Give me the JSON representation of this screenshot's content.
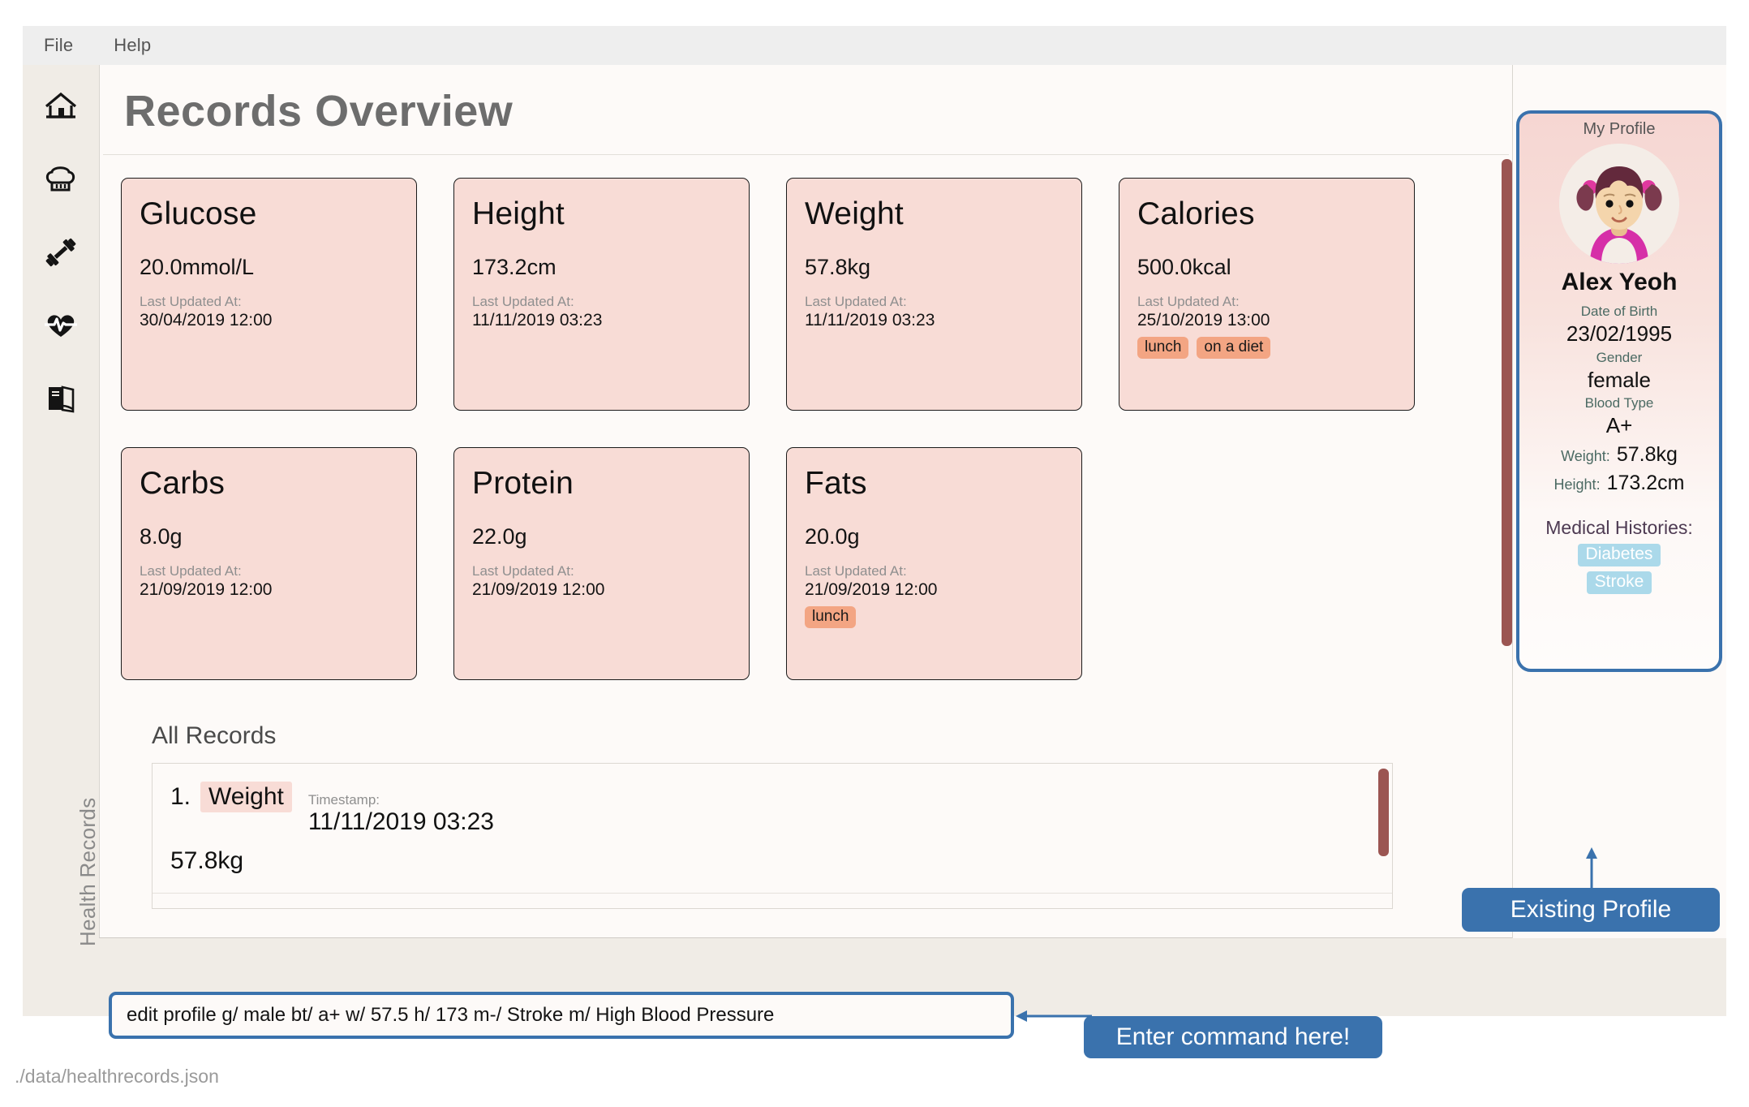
{
  "menu": {
    "items": [
      "File",
      "Help"
    ]
  },
  "sidebar": {
    "icons": [
      {
        "name": "home-icon",
        "label": "Home"
      },
      {
        "name": "chef-hat-icon",
        "label": "Meals"
      },
      {
        "name": "dumbbell-icon",
        "label": "Exercise"
      },
      {
        "name": "heart-pulse-icon",
        "label": "Vitals"
      },
      {
        "name": "journal-icon",
        "label": "Records"
      }
    ],
    "vertical_label": "Health Records"
  },
  "header": {
    "title": "Records Overview"
  },
  "cards": [
    {
      "title": "Glucose",
      "value": "20.0mmol/L",
      "updated_label": "Last Updated At:",
      "updated_at": "30/04/2019 12:00",
      "tags": []
    },
    {
      "title": "Height",
      "value": "173.2cm",
      "updated_label": "Last Updated At:",
      "updated_at": "11/11/2019 03:23",
      "tags": []
    },
    {
      "title": "Weight",
      "value": "57.8kg",
      "updated_label": "Last Updated At:",
      "updated_at": "11/11/2019 03:23",
      "tags": []
    },
    {
      "title": "Calories",
      "value": "500.0kcal",
      "updated_label": "Last Updated At:",
      "updated_at": "25/10/2019 13:00",
      "tags": [
        "lunch",
        "on a diet"
      ]
    },
    {
      "title": "Carbs",
      "value": "8.0g",
      "updated_label": "Last Updated At:",
      "updated_at": "21/09/2019 12:00",
      "tags": []
    },
    {
      "title": "Protein",
      "value": "22.0g",
      "updated_label": "Last Updated At:",
      "updated_at": "21/09/2019 12:00",
      "tags": []
    },
    {
      "title": "Fats",
      "value": "20.0g",
      "updated_label": "Last Updated At:",
      "updated_at": "21/09/2019 12:00",
      "tags": [
        "lunch"
      ]
    }
  ],
  "records": {
    "heading": "All Records",
    "timestamp_label": "Timestamp:",
    "rows": [
      {
        "index": "1.",
        "type": "Weight",
        "timestamp": "11/11/2019 03:23",
        "value": "57.8kg"
      }
    ]
  },
  "profile": {
    "heading": "My Profile",
    "avatar_name": "girl-avatar",
    "name": "Alex Yeoh",
    "dob_label": "Date of Birth",
    "dob": "23/02/1995",
    "gender_label": "Gender",
    "gender": "female",
    "blood_label": "Blood Type",
    "blood": "A+",
    "weight_label": "Weight:",
    "weight": "57.8kg",
    "height_label": "Height:",
    "height": "173.2cm",
    "histories_label": "Medical Histories:",
    "histories": [
      "Diabetes",
      "Stroke"
    ]
  },
  "command": {
    "value": "edit profile g/ male bt/ a+ w/ 57.5 h/ 173 m-/ Stroke m/ High Blood Pressure",
    "placeholder": "Enter command"
  },
  "status": {
    "filepath": "./data/healthrecords.json"
  },
  "callouts": {
    "command": "Enter command here!",
    "profile": "Existing Profile"
  },
  "colors": {
    "accent_blue": "#3a72ad",
    "card_pink": "#f8dcd6",
    "tag_orange": "#f3a583",
    "history_blue": "#abd9ea",
    "scrollbar": "#9b5552"
  }
}
